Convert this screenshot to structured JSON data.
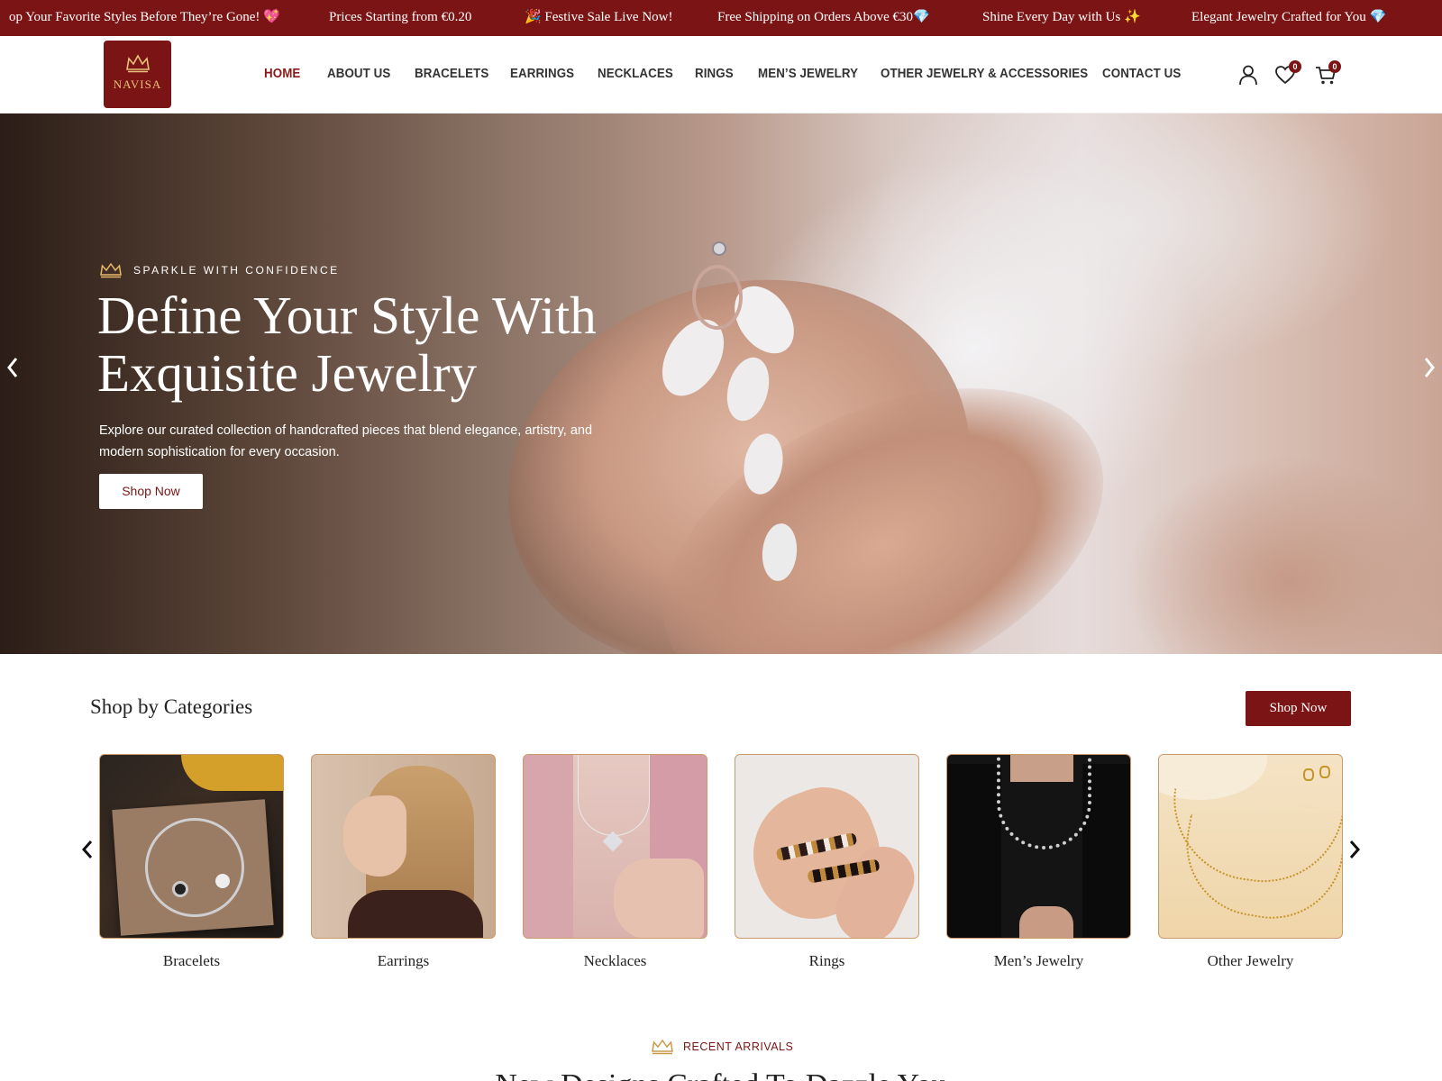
{
  "announcement": {
    "items": [
      "op Your Favorite Styles Before They’re Gone! 💖",
      "Prices Starting from €0.20",
      "🎉 Festive Sale Live Now!",
      "Free Shipping on Orders Above €30💎",
      "Shine Every Day with Us ✨",
      "Elegant Jewelry Crafted for You 💎"
    ]
  },
  "header": {
    "logo_text": "NAVISA",
    "nav": [
      "HOME",
      "ABOUT US",
      "BRACELETS",
      "EARRINGS",
      "NECKLACES",
      "RINGS",
      "MEN’S JEWELRY",
      "OTHER JEWELRY & ACCESSORIES",
      "CONTACT US"
    ],
    "active_nav": "HOME",
    "wishlist_count": "0",
    "cart_count": "0",
    "icons": [
      "user-icon",
      "heart-icon",
      "cart-icon"
    ]
  },
  "hero": {
    "eyebrow": "SPARKLE WITH CONFIDENCE",
    "title": "Define Your Style With Exquisite Jewelry",
    "subtitle": "Explore our curated collection of handcrafted pieces that blend elegance, artistry, and modern sophistication for every occasion.",
    "button": "Shop Now",
    "prev_icon": "chevron-left-icon",
    "next_icon": "chevron-right-icon"
  },
  "categories": {
    "heading": "Shop by Categories",
    "button": "Shop Now",
    "items": [
      "Bracelets",
      "Earrings",
      "Necklaces",
      "Rings",
      "Men’s Jewelry",
      "Other Jewelry"
    ]
  },
  "recent": {
    "eyebrow": "RECENT ARRIVALS",
    "title": "New Designs Crafted To Dazzle You"
  },
  "colors": {
    "brand": "#7b1414",
    "gold": "#c99a6a",
    "text": "#222222"
  }
}
